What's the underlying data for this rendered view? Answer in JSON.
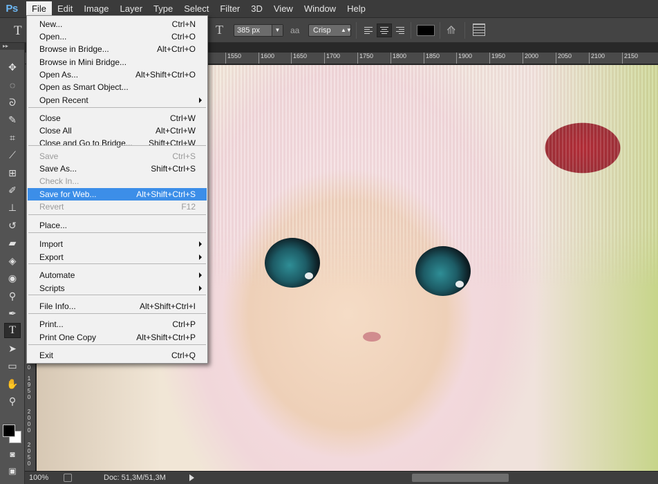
{
  "app": {
    "logo": "Ps"
  },
  "menubar": [
    "File",
    "Edit",
    "Image",
    "Layer",
    "Type",
    "Select",
    "Filter",
    "3D",
    "View",
    "Window",
    "Help"
  ],
  "options": {
    "tool_glyph": "T",
    "orient_glyph": "T",
    "font_size": "385 px",
    "aa_glyph": "aa",
    "aa_method": "Crisp",
    "text_color": "#000000"
  },
  "ruler_top": [
    "1550",
    "1600",
    "1650",
    "1700",
    "1750",
    "1800",
    "1850",
    "1900",
    "1950",
    "2000",
    "2050",
    "2100",
    "2150"
  ],
  "ruler_left": [
    "0",
    "1950",
    "2000",
    "2050"
  ],
  "statusbar": {
    "zoom": "100%",
    "doc": "Doc: 51,3M/51,3M"
  },
  "file_menu": [
    {
      "label": "New...",
      "shortcut": "Ctrl+N"
    },
    {
      "label": "Open...",
      "shortcut": "Ctrl+O"
    },
    {
      "label": "Browse in Bridge...",
      "shortcut": "Alt+Ctrl+O"
    },
    {
      "label": "Browse in Mini Bridge...",
      "shortcut": ""
    },
    {
      "label": "Open As...",
      "shortcut": "Alt+Shift+Ctrl+O"
    },
    {
      "label": "Open as Smart Object...",
      "shortcut": ""
    },
    {
      "label": "Open Recent",
      "shortcut": "",
      "submenu": true
    },
    {
      "label": "Close",
      "shortcut": "Ctrl+W"
    },
    {
      "label": "Close All",
      "shortcut": "Alt+Ctrl+W"
    },
    {
      "label": "Close and Go to Bridge...",
      "shortcut": "Shift+Ctrl+W"
    },
    {
      "label": "Save",
      "shortcut": "Ctrl+S",
      "disabled": true
    },
    {
      "label": "Save As...",
      "shortcut": "Shift+Ctrl+S"
    },
    {
      "label": "Check In...",
      "shortcut": "",
      "disabled": true
    },
    {
      "label": "Save for Web...",
      "shortcut": "Alt+Shift+Ctrl+S",
      "highlighted": true
    },
    {
      "label": "Revert",
      "shortcut": "F12",
      "disabled": true
    },
    {
      "label": "Place...",
      "shortcut": ""
    },
    {
      "label": "Import",
      "shortcut": "",
      "submenu": true
    },
    {
      "label": "Export",
      "shortcut": "",
      "submenu": true
    },
    {
      "label": "Automate",
      "shortcut": "",
      "submenu": true
    },
    {
      "label": "Scripts",
      "shortcut": "",
      "submenu": true
    },
    {
      "label": "File Info...",
      "shortcut": "Alt+Shift+Ctrl+I"
    },
    {
      "label": "Print...",
      "shortcut": "Ctrl+P"
    },
    {
      "label": "Print One Copy",
      "shortcut": "Alt+Shift+Ctrl+P"
    },
    {
      "label": "Exit",
      "shortcut": "Ctrl+Q"
    }
  ],
  "toolbox_icons": [
    "move-icon",
    "marquee-icon",
    "lasso-icon",
    "quick-select-icon",
    "crop-icon",
    "eyedropper-icon",
    "spot-heal-icon",
    "brush-icon",
    "stamp-icon",
    "history-brush-icon",
    "eraser-icon",
    "gradient-icon",
    "blur-icon",
    "dodge-icon",
    "pen-icon",
    "type-icon",
    "path-select-icon",
    "shape-icon",
    "hand-icon",
    "zoom-icon"
  ],
  "colors": {
    "highlight": "#3c8ee8",
    "menu_bg": "#f1f1f1",
    "chrome": "#535353"
  }
}
